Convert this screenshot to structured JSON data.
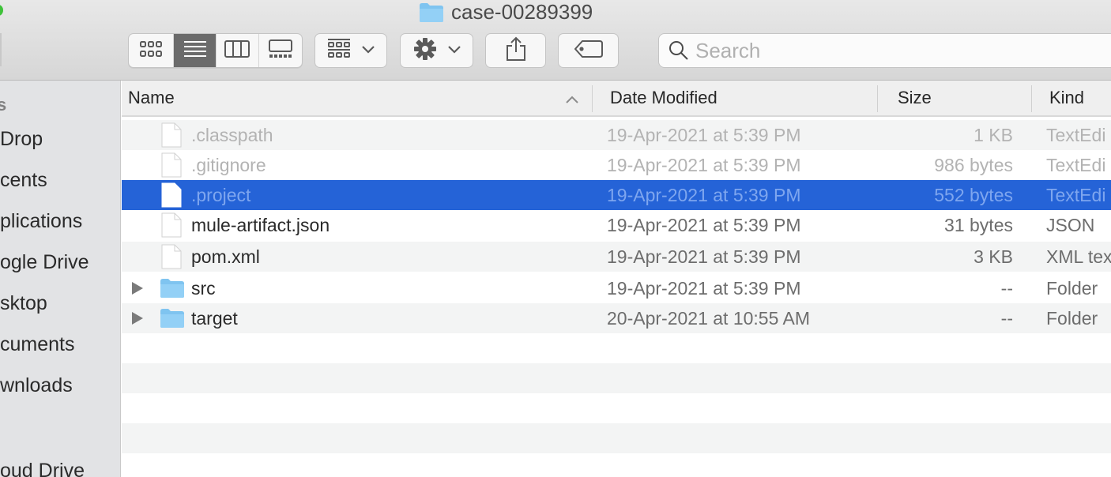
{
  "window": {
    "title": "case-00289399",
    "title_icon": "folder-icon"
  },
  "toolbar": {
    "view_modes": [
      {
        "name": "icon-view",
        "icon": "grid-icon",
        "active": false
      },
      {
        "name": "list-view",
        "icon": "list-icon",
        "active": true
      },
      {
        "name": "column-view",
        "icon": "columns-icon",
        "active": false
      },
      {
        "name": "gallery-view",
        "icon": "gallery-icon",
        "active": false
      }
    ],
    "group_button": {
      "icon": "group-icon",
      "dropdown": "chevron-down-icon"
    },
    "action_button": {
      "icon": "gear-icon",
      "dropdown": "chevron-down-icon"
    },
    "share_button": {
      "icon": "share-icon"
    },
    "tag_button": {
      "icon": "tag-icon"
    },
    "search": {
      "placeholder": "Search",
      "value": ""
    }
  },
  "sidebar": {
    "heading": "s",
    "items": [
      {
        "label": "Drop"
      },
      {
        "label": "cents"
      },
      {
        "label": "plications"
      },
      {
        "label": "ogle Drive"
      },
      {
        "label": "sktop"
      },
      {
        "label": "cuments"
      },
      {
        "label": "wnloads"
      },
      {
        "label": "oud Drive"
      }
    ]
  },
  "list": {
    "columns": {
      "name": "Name",
      "date": "Date Modified",
      "size": "Size",
      "kind": "Kind",
      "sort_indicator": "chevron-up-icon"
    },
    "rows": [
      {
        "name": ".classpath",
        "date": "19-Apr-2021 at 5:39 PM",
        "size": "1 KB",
        "kind": "TextEdi",
        "type": "file",
        "hidden": true,
        "selected": false
      },
      {
        "name": ".gitignore",
        "date": "19-Apr-2021 at 5:39 PM",
        "size": "986 bytes",
        "kind": "TextEdi",
        "type": "file",
        "hidden": true,
        "selected": false
      },
      {
        "name": ".project",
        "date": "19-Apr-2021 at 5:39 PM",
        "size": "552 bytes",
        "kind": "TextEdi",
        "type": "file",
        "hidden": true,
        "selected": true
      },
      {
        "name": "mule-artifact.json",
        "date": "19-Apr-2021 at 5:39 PM",
        "size": "31 bytes",
        "kind": "JSON",
        "type": "file",
        "hidden": false,
        "selected": false
      },
      {
        "name": "pom.xml",
        "date": "19-Apr-2021 at 5:39 PM",
        "size": "3 KB",
        "kind": "XML tex",
        "type": "file",
        "hidden": false,
        "selected": false
      },
      {
        "name": "src",
        "date": "19-Apr-2021 at 5:39 PM",
        "size": "--",
        "kind": "Folder",
        "type": "folder",
        "hidden": false,
        "selected": false
      },
      {
        "name": "target",
        "date": "20-Apr-2021 at 10:55 AM",
        "size": "--",
        "kind": "Folder",
        "type": "folder",
        "hidden": false,
        "selected": false
      }
    ]
  },
  "colors": {
    "selection": "#2563d7",
    "folder": "#8ccdf5",
    "toolbar_active": "#6b6b6b"
  }
}
